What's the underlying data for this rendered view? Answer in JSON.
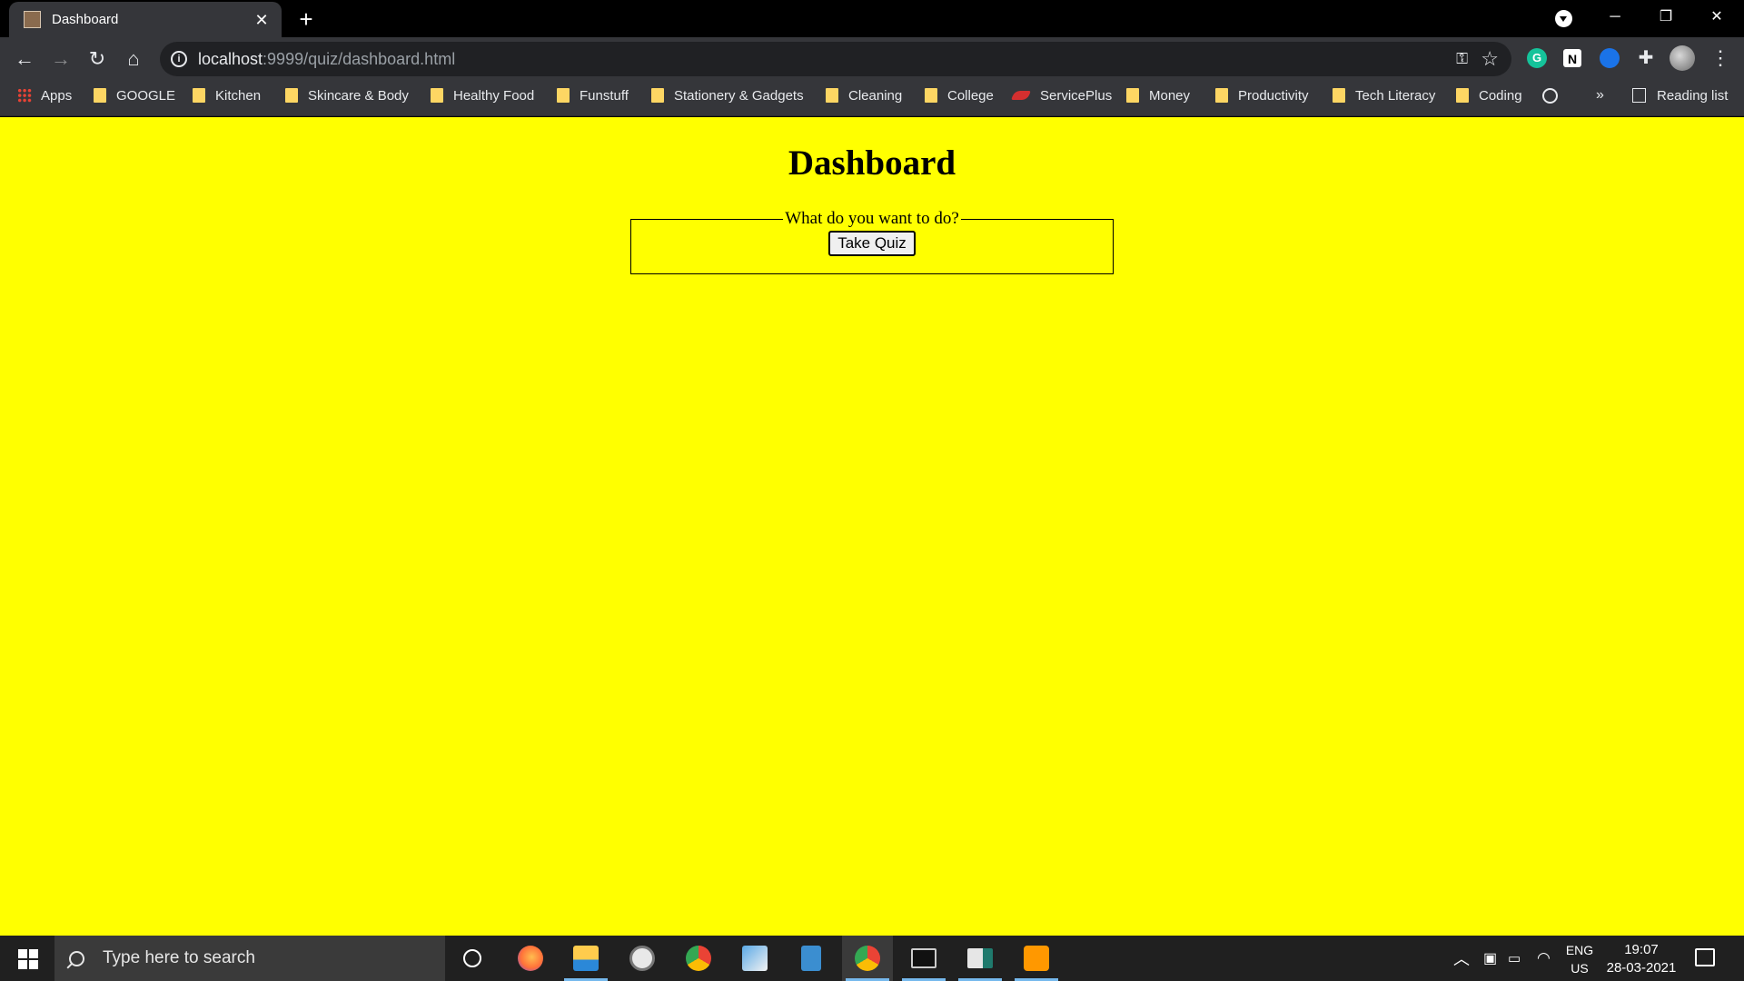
{
  "browser": {
    "tab": {
      "title": "Dashboard",
      "close_icon": "close-icon"
    },
    "new_tab_label": "+",
    "window_controls": {
      "minimize": "─",
      "restore": "❐",
      "close": "✕"
    },
    "address": {
      "host": "localhost",
      "path": ":9999/quiz/dashboard.html"
    },
    "extensions": {
      "grammarly": "G",
      "notion": "N"
    },
    "bookmarks": [
      {
        "label": "Apps",
        "icon": "apps-grid-icon"
      },
      {
        "label": "GOOGLE",
        "icon": "folder-icon"
      },
      {
        "label": "Kitchen",
        "icon": "folder-icon"
      },
      {
        "label": "Skincare & Body",
        "icon": "folder-icon"
      },
      {
        "label": "Healthy Food",
        "icon": "folder-icon"
      },
      {
        "label": "Funstuff",
        "icon": "folder-icon"
      },
      {
        "label": "Stationery & Gadgets",
        "icon": "folder-icon"
      },
      {
        "label": "Cleaning",
        "icon": "folder-icon"
      },
      {
        "label": "College",
        "icon": "folder-icon"
      },
      {
        "label": "ServicePlus",
        "icon": "serviceplus-icon"
      },
      {
        "label": "Money",
        "icon": "folder-icon"
      },
      {
        "label": "Productivity",
        "icon": "folder-icon"
      },
      {
        "label": "Tech Literacy",
        "icon": "folder-icon"
      },
      {
        "label": "Coding",
        "icon": "folder-icon"
      }
    ],
    "overflow_label": "»",
    "reading_list_label": "Reading list"
  },
  "page": {
    "background": "#ffff00",
    "title": "Dashboard",
    "fieldset_legend": "What do you want to do?",
    "take_quiz_label": "Take Quiz"
  },
  "taskbar": {
    "search_placeholder": "Type here to search",
    "language": {
      "line1": "ENG",
      "line2": "US"
    },
    "clock": {
      "time": "19:07",
      "date": "28-03-2021"
    },
    "apps": [
      "cortana-icon",
      "firefox-icon",
      "file-explorer-icon",
      "clock-app-icon",
      "chrome-icon",
      "tool-icon",
      "calculator-icon",
      "chrome-icon",
      "terminal-icon",
      "app-icon",
      "sublime-text-icon"
    ]
  }
}
